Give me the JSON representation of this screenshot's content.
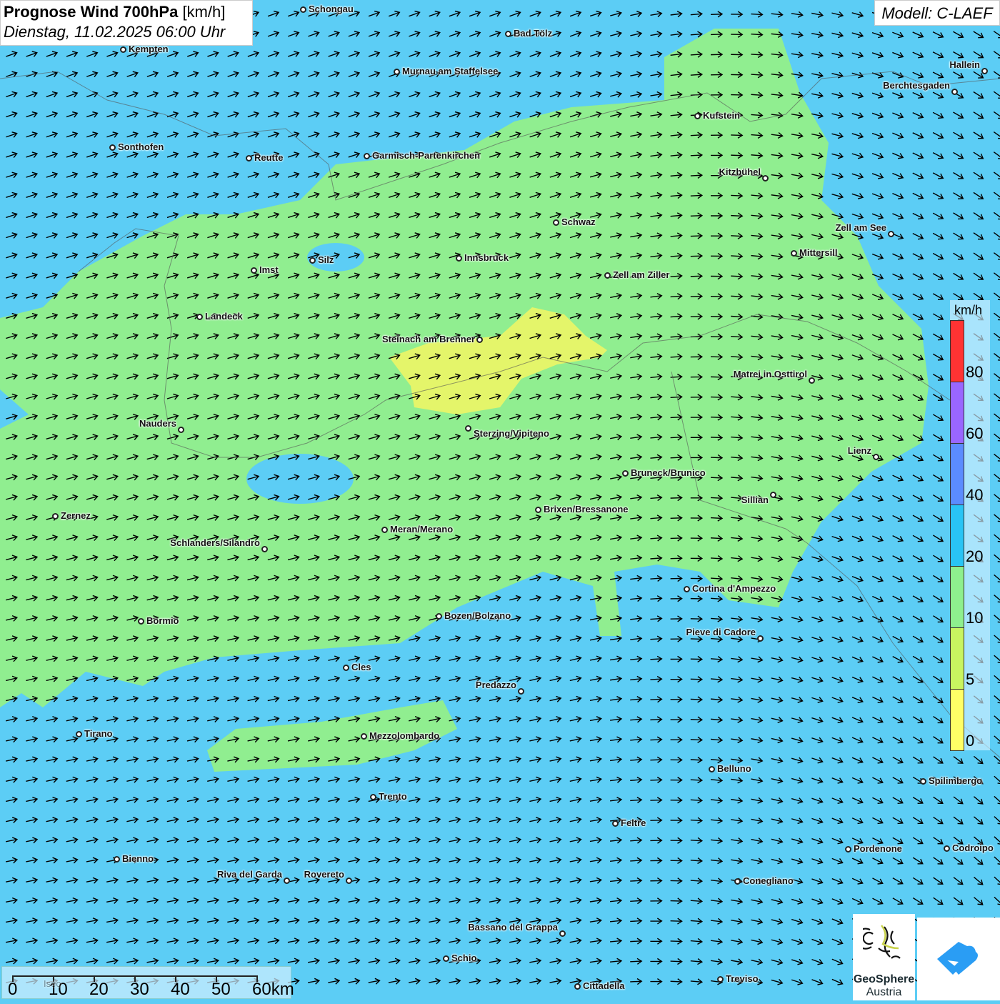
{
  "header": {
    "title_bold": "Prognose Wind 700hPa",
    "title_unit": "[km/h]",
    "datetime": "Dienstag, 11.02.2025 06:00 Uhr",
    "model": "Modell: C-LAEF"
  },
  "legend": {
    "unit": "km/h",
    "labels": [
      "80",
      "60",
      "40",
      "20",
      "10",
      "5",
      "0"
    ],
    "colors": [
      "#ff3333",
      "#9966ff",
      "#5b8cff",
      "#29c4f5",
      "#8ef08e",
      "#c8f560",
      "#ffff66"
    ]
  },
  "scale": {
    "labels": [
      "0",
      "10",
      "20",
      "30",
      "40",
      "50",
      "60km"
    ],
    "hidden_city": "Iseo"
  },
  "logos": {
    "geosphere": "GeoSphere",
    "austria": "Austria"
  },
  "colors": {
    "water_blue": "#5ccdf5",
    "wind_green": "#90ee90",
    "wind_yellow": "#e4f56a"
  },
  "cities": [
    "Schongau",
    "Bad Tölz",
    "Kempten",
    "Murnau am Staffelsee",
    "Hallein",
    "Berchtesgaden",
    "Kufstein",
    "Sonthofen",
    "Reutte",
    "Garmisch-Partenkirchen",
    "Kitzbühel",
    "Schwaz",
    "Zell am See",
    "Mittersill",
    "Innsbruck",
    "Silz",
    "Imst",
    "Zell am Ziller",
    "Landeck",
    "Steinach am Brenner",
    "Matrei in Osttirol",
    "Nauders",
    "Sterzing/Vipiteno",
    "Lienz",
    "Bruneck/Brunico",
    "Sillian",
    "Brixen/Bressanone",
    "Zernez",
    "Meran/Merano",
    "Schlanders/Silandro",
    "Cortina d'Ampezzo",
    "Bozen/Bolzano",
    "Bormio",
    "Pieve di Cadore",
    "Cles",
    "Predazzo",
    "Tirano",
    "Mezzolombardo",
    "Belluno",
    "Spilimbergo",
    "Trento",
    "Feltre",
    "Pordenone",
    "Codroipo",
    "Bienno",
    "Riva del Garda",
    "Rovereto",
    "Conegliano",
    "Bassano del Grappa",
    "Schio",
    "Treviso",
    "Cittadella"
  ]
}
